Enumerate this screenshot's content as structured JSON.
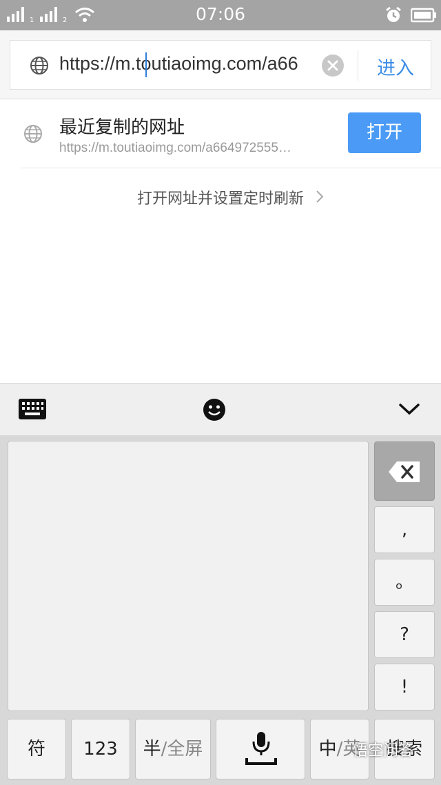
{
  "status_bar": {
    "time": "07:06",
    "sim1": "1",
    "sim2": "2"
  },
  "url_bar": {
    "value": "https://m.toutiaoimg.com/a66",
    "go_label": "进入"
  },
  "recent": {
    "title": "最近复制的网址",
    "url": "https://m.toutiaoimg.com/a664972555…",
    "open_label": "打开"
  },
  "refresh_link": {
    "label": "打开网址并设置定时刷新"
  },
  "keyboard": {
    "punct": [
      ",",
      "。",
      "?",
      "!"
    ],
    "bottom_keys": {
      "symbols": "符",
      "numbers": "123",
      "half": "半",
      "full": "/全屏",
      "zh": "中",
      "en": "/英",
      "search": "搜索"
    }
  },
  "watermark": "悟空问答",
  "colors": {
    "accent": "#4b9bf6",
    "link": "#3c8de6",
    "status_bar": "#a4a4a4"
  }
}
